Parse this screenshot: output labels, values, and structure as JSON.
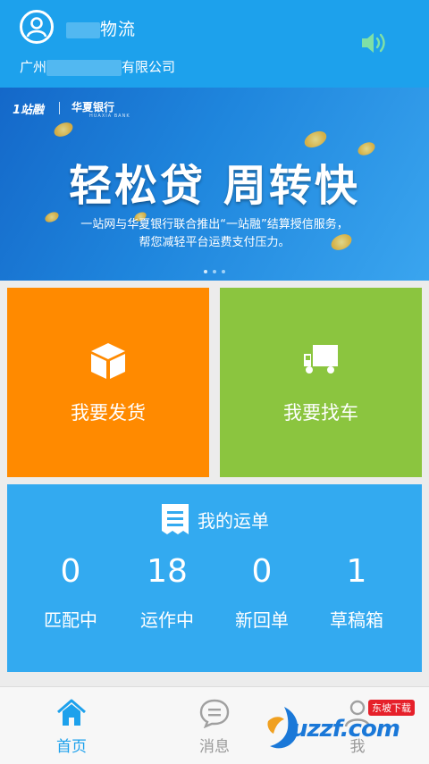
{
  "header": {
    "company_short_suffix": "物流",
    "company_full_prefix": "广州",
    "company_full_suffix": "有限公司"
  },
  "banner": {
    "brand1": "1站融",
    "brand2": "华夏银行",
    "brand2_sub": "HUAXIA BANK",
    "headline": "轻松贷  周转快",
    "sub_line1": "一站网与华夏银行联合推出“一站融”结算授信服务，",
    "sub_line2": "帮您减轻平台运费支付压力。"
  },
  "tiles": {
    "ship_label": "我要发货",
    "car_label": "我要找车"
  },
  "orders": {
    "title": "我的运单",
    "stats": [
      {
        "num": "0",
        "label": "匹配中"
      },
      {
        "num": "18",
        "label": "运作中"
      },
      {
        "num": "0",
        "label": "新回单"
      },
      {
        "num": "1",
        "label": "草稿箱"
      }
    ]
  },
  "tabbar": {
    "home": "首页",
    "messages": "消息",
    "me": "我"
  },
  "watermark": {
    "text": "uzzf.com",
    "tag": "东坡下载"
  },
  "colors": {
    "header": "#1da1ec",
    "ship_tile": "#ff8a00",
    "car_tile": "#8bc53f",
    "orders_panel": "#33aaf0"
  }
}
